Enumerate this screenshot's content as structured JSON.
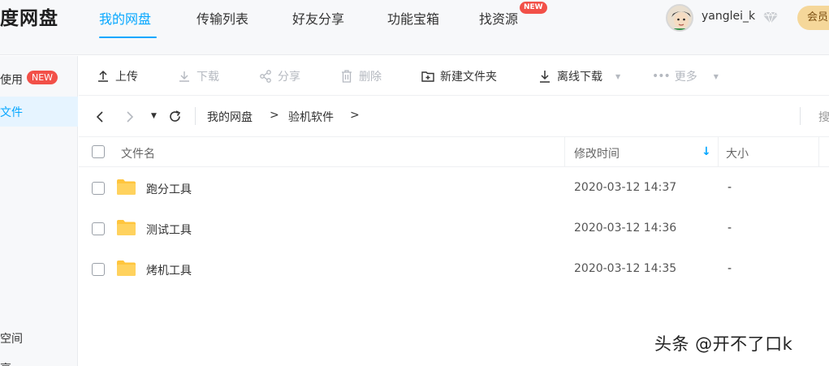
{
  "app": {
    "logo_text": "度网盘"
  },
  "nav": {
    "tabs": [
      {
        "label": "我的网盘"
      },
      {
        "label": "传输列表"
      },
      {
        "label": "好友分享"
      },
      {
        "label": "功能宝箱"
      },
      {
        "label": "找资源"
      }
    ],
    "new_badge": "NEW",
    "active_tab": "我的网盘",
    "accent_color": "#06a7ff"
  },
  "user": {
    "name": "yanglei_k",
    "member_label": "会员"
  },
  "sidebar": {
    "items": [
      {
        "label": "使用"
      },
      {
        "label": "文件"
      },
      {
        "label": "空间"
      },
      {
        "label": "享"
      }
    ],
    "new_badge": "NEW"
  },
  "toolbar": {
    "upload": "上传",
    "download": "下载",
    "share": "分享",
    "delete": "删除",
    "new_folder": "新建文件夹",
    "offline_download": "离线下载",
    "more": "更多"
  },
  "path": {
    "crumbs": [
      "我的网盘",
      "验机软件"
    ],
    "separator": ">",
    "search_stub": "搜"
  },
  "table": {
    "headers": {
      "name": "文件名",
      "modified": "修改时间",
      "size": "大小"
    },
    "sort_indicator": "↓",
    "rows": [
      {
        "name": "跑分工具",
        "modified": "2020-03-12 14:37",
        "size": "-"
      },
      {
        "name": "测试工具",
        "modified": "2020-03-12 14:36",
        "size": "-"
      },
      {
        "name": "烤机工具",
        "modified": "2020-03-12 14:35",
        "size": "-"
      }
    ]
  },
  "watermark": "头条 @开不了口k"
}
